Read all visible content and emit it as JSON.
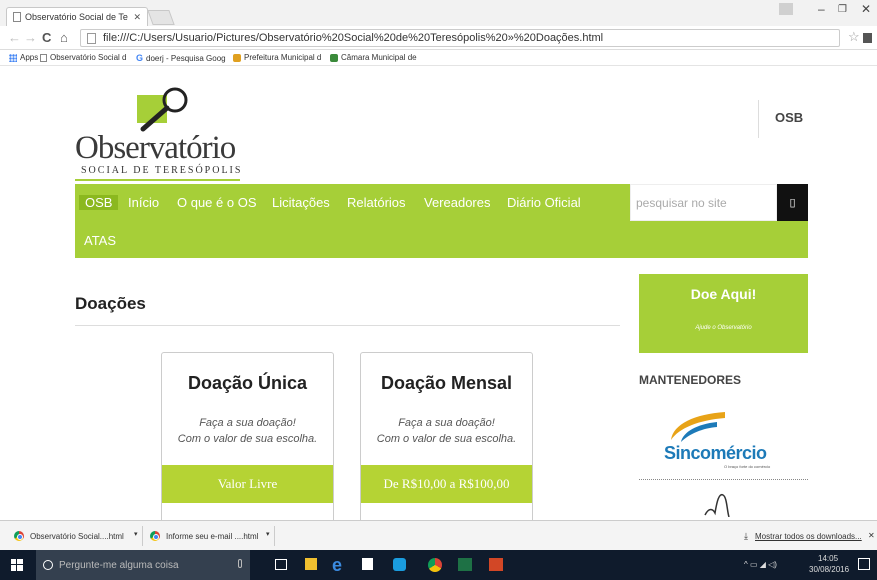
{
  "browser": {
    "tab_title": "Observatório Social de Te",
    "url": "file:///C:/Users/Usuario/Pictures/Observat%C3%B3rio%20Social%20de%20Teres%C3%B3polis%20»%20Doa%C3%A7%C3%B5es.html",
    "url_display": "file:///C:/Users/Usuario/Pictures/Observatório%20Social%20de%20Teresópolis%20»%20Doações.html",
    "bookmarks": [
      {
        "label": "Apps",
        "icon": "apps-grid-icon"
      },
      {
        "label": "Observatório Social d",
        "icon": "page-icon"
      },
      {
        "label": "doerj - Pesquisa Goog",
        "icon": "google-icon"
      },
      {
        "label": "Prefeitura Municipal d",
        "icon": "crest-icon"
      },
      {
        "label": "Câmara Municipal de",
        "icon": "crest-icon"
      }
    ]
  },
  "site": {
    "logo_word": "Observatório",
    "logo_sub": "SOCIAL DE TERESÓPOLIS",
    "top_link": "OSB",
    "nav": [
      "OSB",
      "Início",
      "O que é o OS",
      "Licitações",
      "Relatórios",
      "Vereadores",
      "Diário Oficial",
      "ATAS"
    ],
    "search_placeholder": "pesquisar no site",
    "page_title": "Doações",
    "cards": [
      {
        "title": "Doação Única",
        "desc1": "Faça a sua doação!",
        "desc2": "Com o valor de sua escolha.",
        "band": "Valor Livre"
      },
      {
        "title": "Doação Mensal",
        "desc1": "Faça a sua doação!",
        "desc2": "Com o valor de sua escolha.",
        "band": "De R$10,00 a R$100,00"
      }
    ],
    "donate": {
      "title": "Doe Aqui!",
      "subtitle": "Ajude o Observatório"
    },
    "sponsors_title": "MANTENEDORES",
    "sponsor_name": "Sincomércio",
    "sponsor_tag": "O braço forte do comércio",
    "accent": "#a6cf38"
  },
  "downloads": {
    "items": [
      "Observatório Social....html",
      "Informe seu e-mail ....html"
    ],
    "show_all": "Mostrar todos os downloads..."
  },
  "taskbar": {
    "search_placeholder": "Pergunte-me alguma coisa",
    "time": "14:05",
    "date": "30/08/2016"
  }
}
